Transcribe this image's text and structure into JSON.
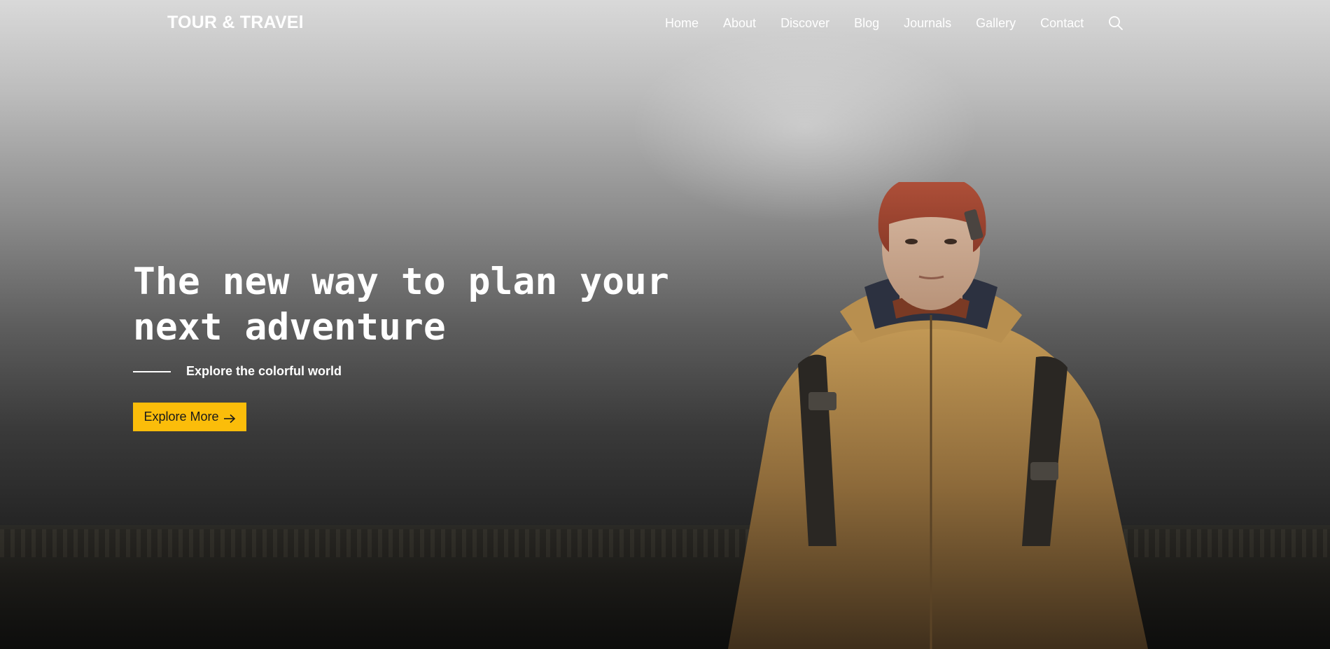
{
  "brand": {
    "logo": "TOUR & TRAVEl"
  },
  "nav": {
    "items": [
      {
        "label": "Home"
      },
      {
        "label": "About"
      },
      {
        "label": "Discover"
      },
      {
        "label": "Blog"
      },
      {
        "label": "Journals"
      },
      {
        "label": "Gallery"
      },
      {
        "label": "Contact"
      }
    ],
    "search_icon": "search-icon"
  },
  "hero": {
    "headline_line1": "The new way to plan your",
    "headline_line2": "next adventure",
    "tagline": "Explore the colorful world",
    "cta_label": "Explore More",
    "cta_icon": "arrow-right-icon",
    "image": "traveler-in-red-beanie-and-yellow-jacket"
  },
  "colors": {
    "accent": "#fbbd0a",
    "text": "#ffffff"
  }
}
